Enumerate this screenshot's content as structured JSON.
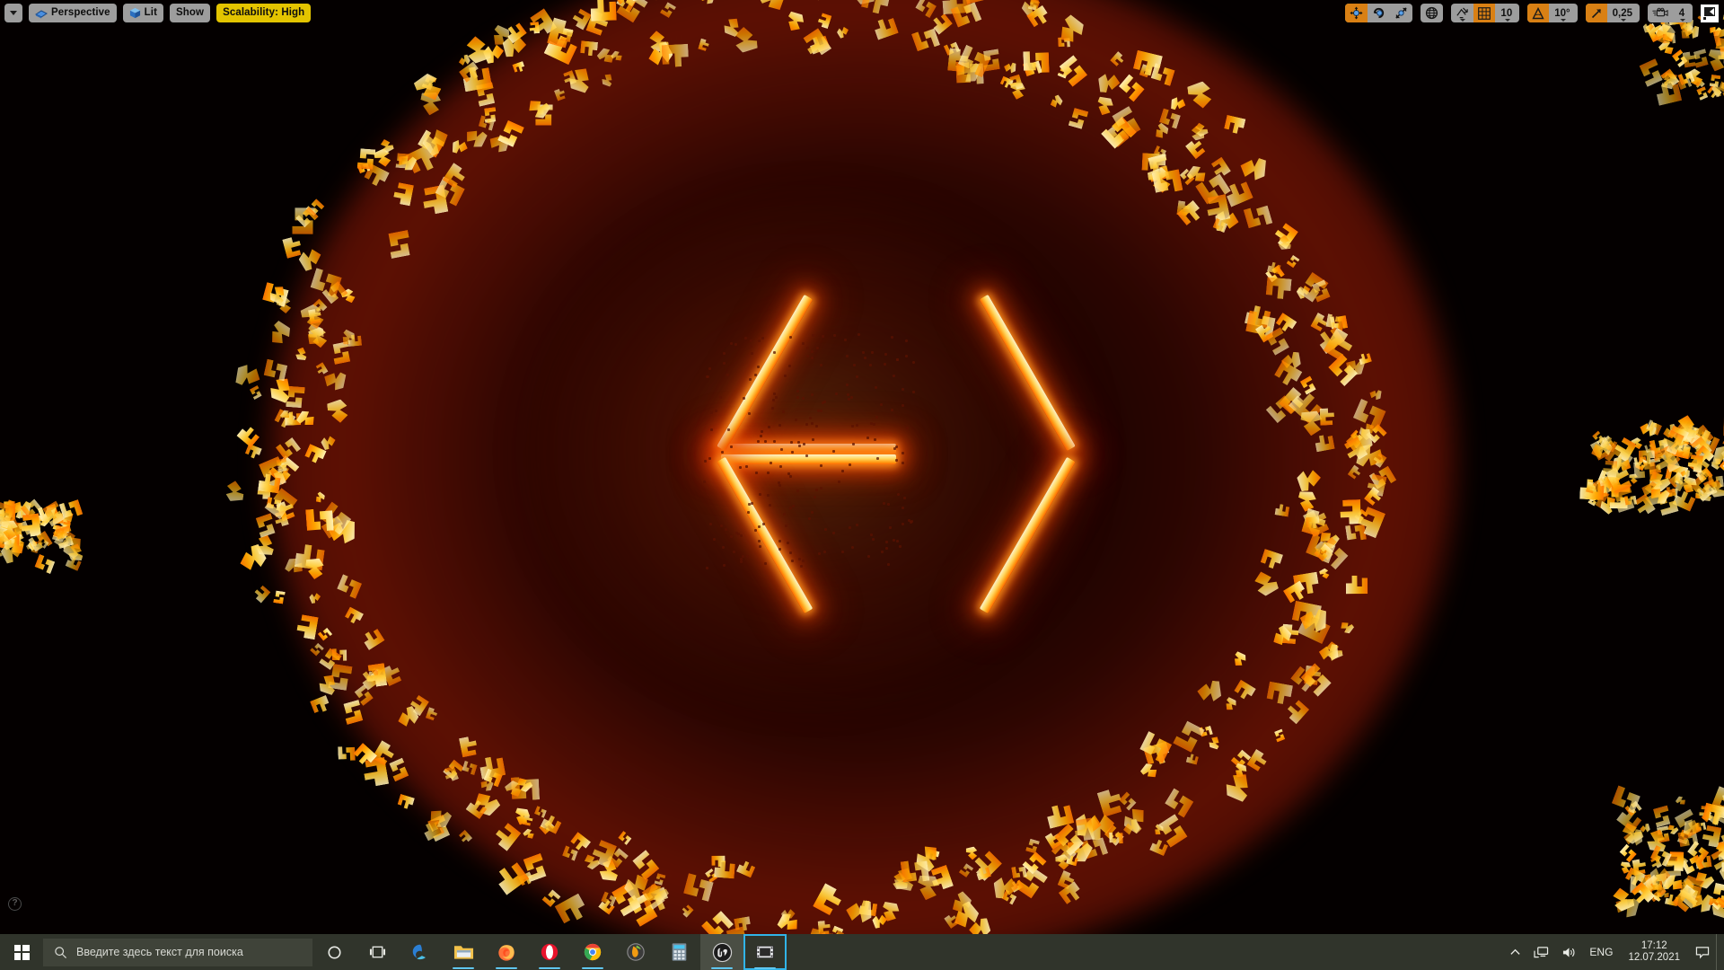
{
  "viewport": {
    "toolbar_left": [
      {
        "name": "viewport-options-dropdown",
        "label": "",
        "icon": "chevron-down-icon",
        "highlight": false
      },
      {
        "name": "camera-perspective-button",
        "label": "Perspective",
        "icon": "camera-icon",
        "highlight": false
      },
      {
        "name": "view-mode-lit-button",
        "label": "Lit",
        "icon": "cube-icon",
        "highlight": false
      },
      {
        "name": "show-flags-button",
        "label": "Show",
        "icon": "",
        "highlight": false
      },
      {
        "name": "scalability-button",
        "label": "Scalability: High",
        "icon": "",
        "highlight": true
      }
    ],
    "toolbar_right": {
      "transform_group": [
        {
          "name": "select-move-tool",
          "icon": "move-gizmo-icon",
          "active": true
        },
        {
          "name": "rotate-tool",
          "icon": "rotate-gizmo-icon",
          "active": false
        },
        {
          "name": "scale-tool",
          "icon": "scale-gizmo-icon",
          "active": false
        }
      ],
      "coordinate_system": {
        "name": "world-coordinate-toggle",
        "icon": "globe-icon",
        "active": false
      },
      "surface_snap": {
        "name": "surface-snap-toggle",
        "icon": "surface-snap-icon",
        "active": false
      },
      "grid_snap": {
        "name": "grid-snap-toggle",
        "icon": "grid-icon",
        "active": true,
        "value": "10"
      },
      "angle_snap": {
        "name": "angle-snap-toggle",
        "icon": "angle-icon",
        "active": true,
        "value": "10°"
      },
      "scale_snap": {
        "name": "scale-snap-toggle",
        "icon": "scale-snap-icon",
        "active": true,
        "value": "0,25"
      },
      "camera_speed": {
        "name": "camera-speed-control",
        "icon": "camera-speed-icon",
        "value": "4"
      },
      "maximize": {
        "name": "maximize-viewport-button",
        "icon": "maximize-icon"
      }
    },
    "help_icon": {
      "name": "help-icon",
      "label": "?"
    },
    "scene": {
      "colors": {
        "background": "#040000",
        "glow_red": "#8a1204",
        "particle_core": "#fff0bd",
        "particle_mid": "#ffd257",
        "particle_edge": "#ff7a05"
      },
      "elements": [
        {
          "name": "hexagram-star",
          "description": "glowing six-pointed star"
        },
        {
          "name": "particle-ring",
          "description": "circular ring of glowing mesh particles"
        },
        {
          "name": "particle-cluster-left",
          "description": "glowing cluster at left edge"
        },
        {
          "name": "particle-cluster-right",
          "description": "glowing cluster at right edge"
        }
      ]
    }
  },
  "taskbar": {
    "start": {
      "name": "start-button",
      "icon": "windows-logo-icon"
    },
    "search": {
      "name": "search-input",
      "placeholder": "Введите здесь текст для поиска",
      "icon": "search-icon"
    },
    "buttons": [
      {
        "name": "cortana-button",
        "icon": "cortana-icon",
        "running": false,
        "active": false,
        "focus": false
      },
      {
        "name": "task-view-button",
        "icon": "task-view-icon",
        "running": false,
        "active": false,
        "focus": false
      },
      {
        "name": "taskbar-item-edge",
        "icon": "edge-icon",
        "running": false,
        "active": false,
        "focus": false
      },
      {
        "name": "taskbar-item-file-explorer",
        "icon": "folder-icon",
        "running": true,
        "active": false,
        "focus": false
      },
      {
        "name": "taskbar-item-firefox",
        "icon": "firefox-icon",
        "running": true,
        "active": false,
        "focus": false
      },
      {
        "name": "taskbar-item-opera",
        "icon": "opera-icon",
        "running": true,
        "active": false,
        "focus": false
      },
      {
        "name": "taskbar-item-chrome",
        "icon": "chrome-icon",
        "running": true,
        "active": false,
        "focus": false
      },
      {
        "name": "taskbar-item-fl-studio",
        "icon": "fl-studio-icon",
        "running": false,
        "active": false,
        "focus": false
      },
      {
        "name": "taskbar-item-calculator",
        "icon": "calculator-icon",
        "running": false,
        "active": false,
        "focus": false
      },
      {
        "name": "taskbar-item-unreal-engine",
        "icon": "unreal-engine-icon",
        "running": true,
        "active": true,
        "focus": false
      },
      {
        "name": "taskbar-item-media",
        "icon": "film-icon",
        "running": true,
        "active": false,
        "focus": true
      }
    ],
    "tray": {
      "overflow": {
        "name": "tray-overflow-button",
        "icon": "chevron-up-icon"
      },
      "network": {
        "name": "network-icon",
        "icon": "network-icon"
      },
      "volume": {
        "name": "volume-icon",
        "icon": "speaker-icon"
      },
      "language": {
        "name": "language-indicator",
        "label": "ENG"
      },
      "clock": {
        "name": "clock",
        "time": "17:12",
        "date": "12.07.2021"
      },
      "notifications": {
        "name": "notifications-button",
        "icon": "chat-bubble-icon"
      },
      "show_desktop": {
        "name": "show-desktop-button"
      }
    }
  }
}
